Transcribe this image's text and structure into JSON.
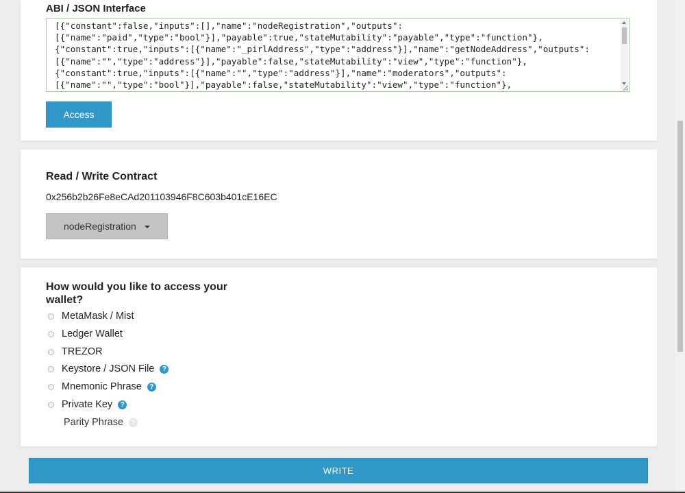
{
  "abi": {
    "label": "ABI / JSON Interface",
    "content": "[{\"constant\":false,\"inputs\":[],\"name\":\"nodeRegistration\",\"outputs\":\n[{\"name\":\"paid\",\"type\":\"bool\"}],\"payable\":true,\"stateMutability\":\"payable\",\"type\":\"function\"},\n{\"constant\":true,\"inputs\":[{\"name\":\"_pirlAddress\",\"type\":\"address\"}],\"name\":\"getNodeAddress\",\"outputs\":\n[{\"name\":\"\",\"type\":\"address\"}],\"payable\":false,\"stateMutability\":\"view\",\"type\":\"function\"},\n{\"constant\":true,\"inputs\":[{\"name\":\"\",\"type\":\"address\"}],\"name\":\"moderators\",\"outputs\":\n[{\"name\":\"\",\"type\":\"bool\"}],\"payable\":false,\"stateMutability\":\"view\",\"type\":\"function\"},\n{\"constant\":true,\"inputs\":[{\"name\":\"\",\"type\":\"address\"}],\"name\":\"nodes\",\"outputs\":",
    "access_label": "Access"
  },
  "contract": {
    "title": "Read / Write Contract",
    "address": "0x256b2b26Fe8eCAd201103946F8C603b401cE16EC",
    "selected_function": "nodeRegistration"
  },
  "wallet": {
    "title": "How would you like to access your wallet?",
    "options": [
      {
        "label": "MetaMask / Mist",
        "help": false
      },
      {
        "label": "Ledger Wallet",
        "help": false
      },
      {
        "label": "TREZOR",
        "help": false
      },
      {
        "label": "Keystore / JSON File",
        "help": true
      },
      {
        "label": "Mnemonic Phrase",
        "help": true
      },
      {
        "label": "Private Key",
        "help": true
      }
    ],
    "parity_label": "Parity Phrase",
    "help_glyph": "?"
  },
  "write_label": "WRITE"
}
